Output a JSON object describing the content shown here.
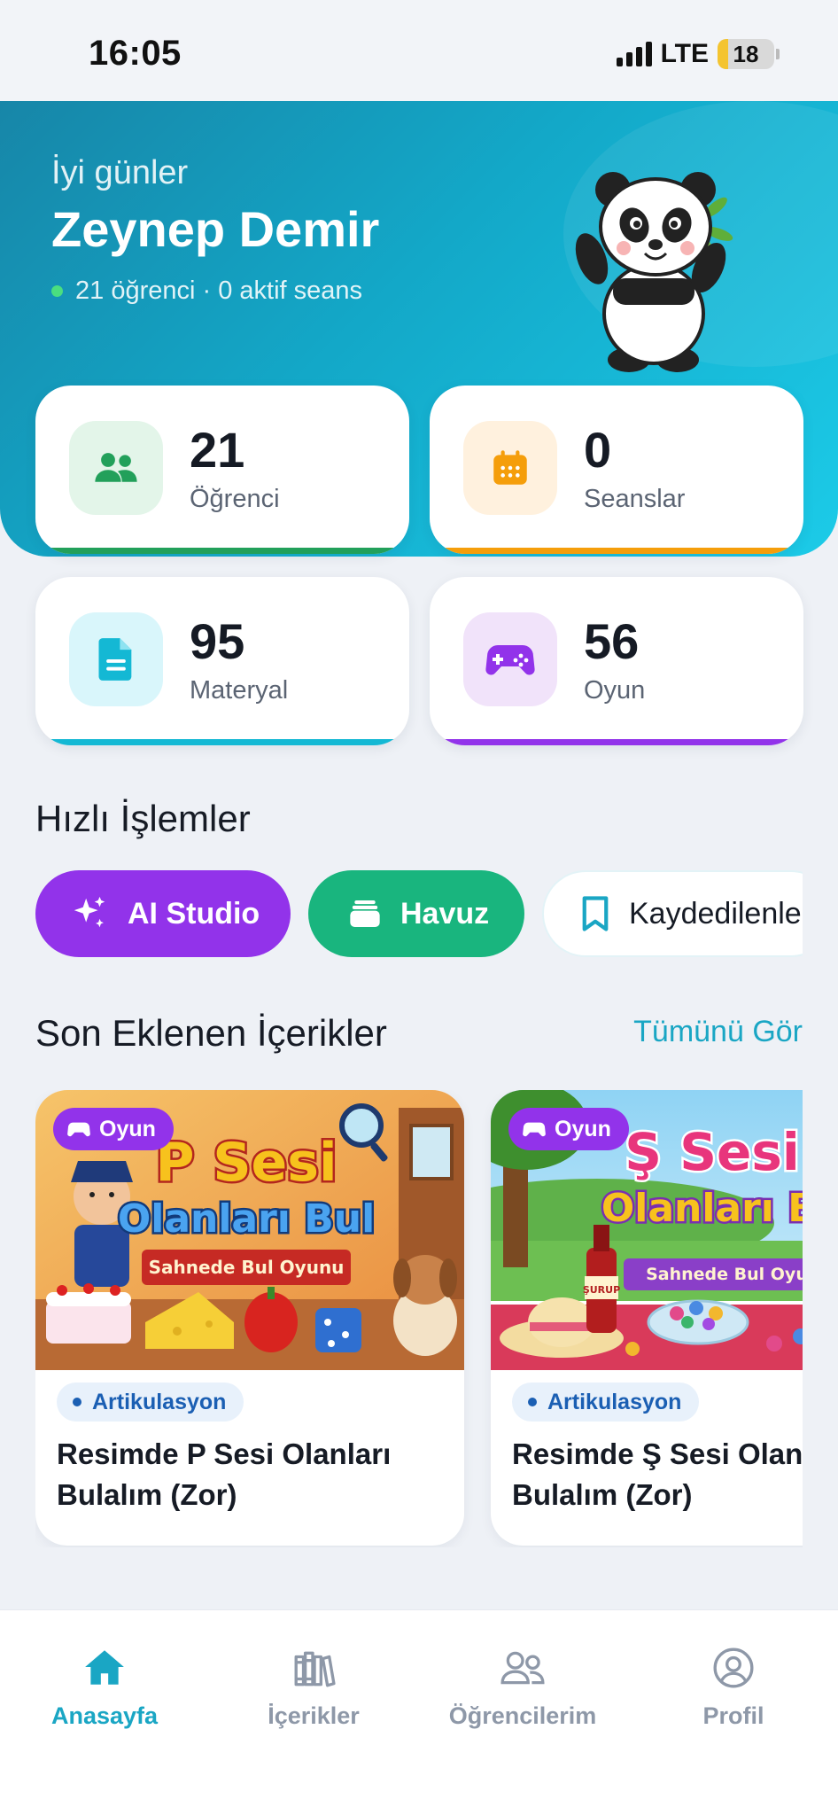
{
  "status_bar": {
    "time": "16:05",
    "network": "LTE",
    "battery": "18"
  },
  "hero": {
    "greeting": "İyi günler",
    "name": "Zeynep Demir",
    "summary": "21 öğrenci · 0 aktif seans"
  },
  "stats": [
    {
      "value": "21",
      "label": "Öğrenci",
      "icon": "users-icon",
      "color": "#22a05a",
      "bg": "#e3f5e9"
    },
    {
      "value": "0",
      "label": "Seanslar",
      "icon": "calendar-icon",
      "color": "#f59e0b",
      "bg": "#fff1de"
    },
    {
      "value": "95",
      "label": "Materyal",
      "icon": "document-icon",
      "color": "#14b8d4",
      "bg": "#d9f6fb"
    },
    {
      "value": "56",
      "label": "Oyun",
      "icon": "gamepad-icon",
      "color": "#9233ea",
      "bg": "#f1e3fa"
    }
  ],
  "quick_actions": {
    "title": "Hızlı İşlemler",
    "items": [
      {
        "label": "AI Studio",
        "icon": "sparkles-icon"
      },
      {
        "label": "Havuz",
        "icon": "stack-icon"
      },
      {
        "label": "Kaydedilenler",
        "icon": "bookmark-icon"
      }
    ]
  },
  "recent": {
    "title": "Son Eklenen İçerikler",
    "see_all": "Tümünü Gör",
    "items": [
      {
        "type": "Oyun",
        "category": "Artikulasyon",
        "title": "Resimde P Sesi Olanları Bulalım (Zor)",
        "thumb_line1": "P Sesi",
        "thumb_line2": "Olanları Bul",
        "thumb_banner": "Sahnede Bul Oyunu"
      },
      {
        "type": "Oyun",
        "category": "Artikulasyon",
        "title": "Resimde Ş Sesi Olanları Bulalım (Zor)",
        "thumb_line1": "Ş Sesi",
        "thumb_line2": "Olanları Bul",
        "thumb_banner": "Sahnede Bul Oyunu",
        "thumb_label": "ŞURUP"
      }
    ]
  },
  "bottom_nav": {
    "items": [
      {
        "label": "Anasayfa",
        "icon": "home-icon",
        "active": true
      },
      {
        "label": "İçerikler",
        "icon": "library-icon",
        "active": false
      },
      {
        "label": "Öğrencilerim",
        "icon": "students-icon",
        "active": false
      },
      {
        "label": "Profil",
        "icon": "profile-icon",
        "active": false
      }
    ]
  }
}
